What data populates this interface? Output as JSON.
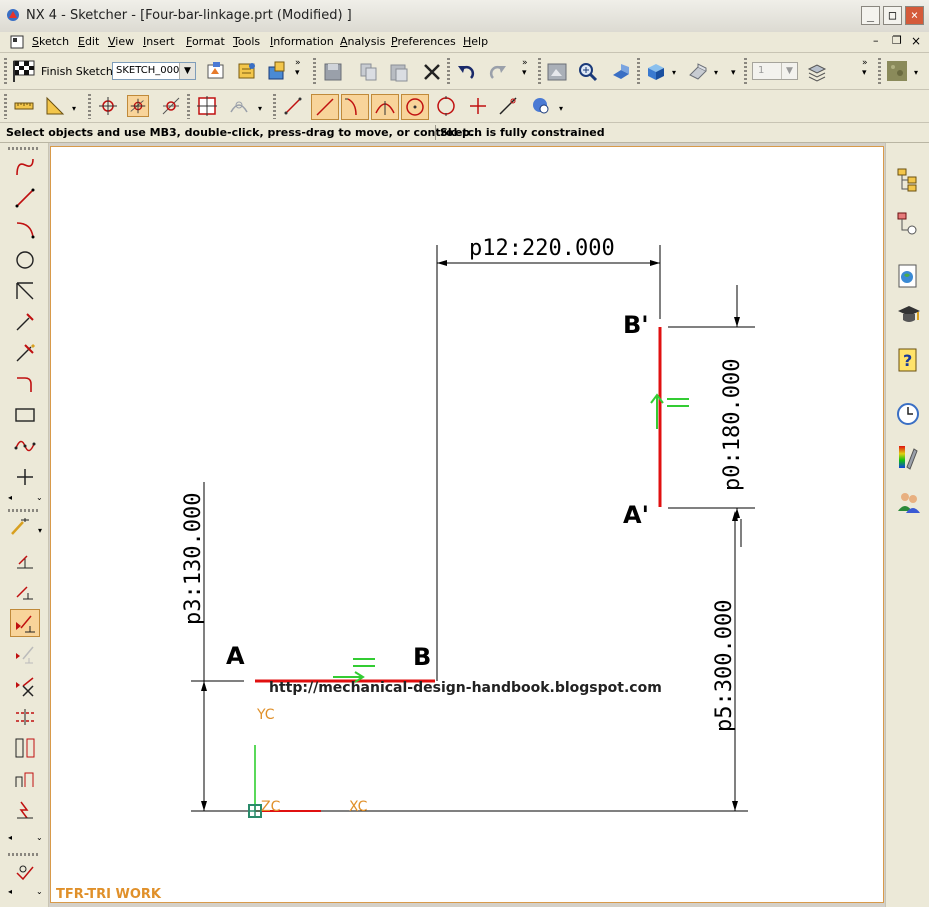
{
  "window": {
    "title": "NX 4 - Sketcher - [Four-bar-linkage.prt (Modified) ]"
  },
  "menu": {
    "items": [
      "Sketch",
      "Edit",
      "View",
      "Insert",
      "Format",
      "Tools",
      "Information",
      "Analysis",
      "Preferences",
      "Help"
    ]
  },
  "toolbar": {
    "finish_label": "Finish Sketch",
    "sketch_name": "SKETCH_000",
    "layer_value": "1"
  },
  "status": {
    "prompt": "Select objects and use MB3, double-click, press-drag to move, or control-p...",
    "constraint": "Sketch is fully constrained"
  },
  "sketch": {
    "dims": {
      "p12": "p12:220.000",
      "p0": "p0:180.000",
      "p3": "p3:130.000",
      "p5": "p5:300.000"
    },
    "points": {
      "A": "A",
      "B": "B",
      "Bp": "B'",
      "Ap": "A'"
    },
    "axes": {
      "yc": "YC",
      "xc": "XC",
      "zc": "ZC"
    },
    "watermark": "http://mechanical-design-handbook.blogspot.com",
    "footer": "TFR-TRI WORK"
  },
  "colors": {
    "link": "#e01010",
    "constraint": "#33cc33",
    "axis": "#e0902a",
    "dim": "#000000"
  },
  "icons": {
    "left": [
      "profile-icon",
      "line-icon",
      "arc-icon",
      "circle-icon",
      "quick-trim-icon",
      "quick-extend-icon",
      "fillet-icon",
      "corner-icon",
      "rectangle-icon",
      "studio-spline-icon",
      "point-icon",
      "inferred-dimension-icon",
      "constraints-icon",
      "show-all-constraints-icon",
      "auto-constrain-icon",
      "show-no-constraints-icon",
      "show-remove-constraints-icon",
      "convert-reference-icon",
      "alternate-solution-icon",
      "inferred-constraints-icon",
      "create-inferred-constraints-icon"
    ],
    "right": [
      "part-navigator-icon",
      "assembly-navigator-icon",
      "web-browser-icon",
      "training-icon",
      "help-icon",
      "history-icon",
      "visualization-icon",
      "roles-icon"
    ]
  }
}
